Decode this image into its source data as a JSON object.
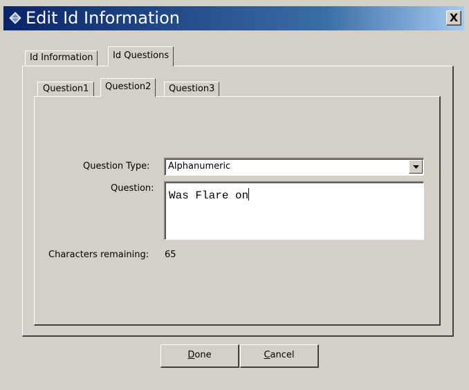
{
  "window": {
    "title": "Edit Id Information",
    "close_label": "X"
  },
  "outer_tabs": [
    {
      "label": "Id Information",
      "active": false
    },
    {
      "label": "Id Questions",
      "active": true
    }
  ],
  "inner_tabs": [
    {
      "label": "Question1",
      "active": false
    },
    {
      "label": "Question2",
      "active": true
    },
    {
      "label": "Question3",
      "active": false
    }
  ],
  "form": {
    "question_type_label": "Question Type:",
    "question_type_value": "Alphanumeric",
    "question_label": "Question:",
    "question_value": "Was Flare on",
    "chars_remaining_label": "Characters remaining:",
    "chars_remaining_value": "65"
  },
  "buttons": {
    "done": {
      "mnemonic": "D",
      "rest": "one"
    },
    "cancel": {
      "mnemonic": "C",
      "rest": "ancel"
    }
  },
  "colors": {
    "face": "#d4d0c8",
    "title_start": "#0a246a",
    "title_end": "#a6caf0"
  }
}
